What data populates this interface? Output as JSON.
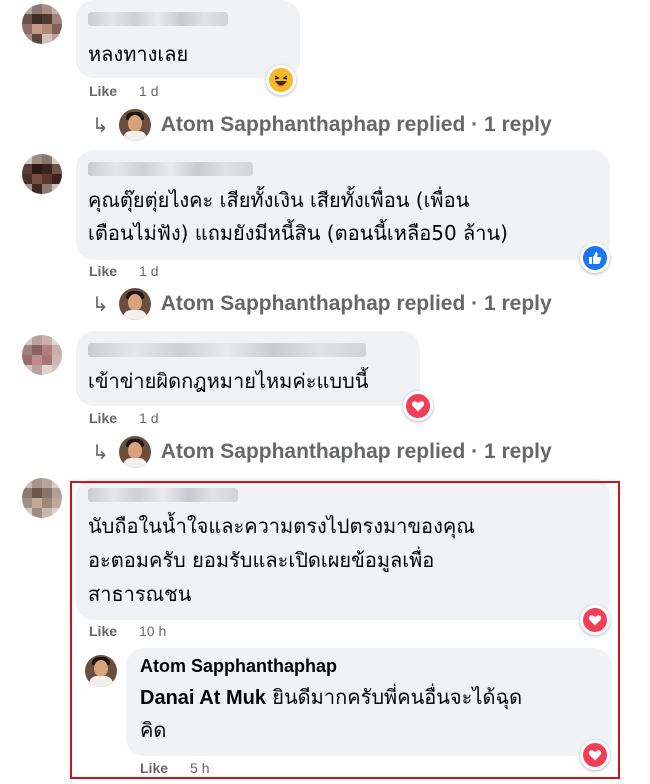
{
  "comments": [
    {
      "text_lines": [
        "หลงทางเลย"
      ],
      "like_label": "Like",
      "time": "1 d",
      "reaction_icon": "haha-icon",
      "reply_summary": "Atom Sapphanthaphap replied · 1 reply"
    },
    {
      "text_lines": [
        "คุณตุ๊ยตุ่ยไงคะ เสียทั้งเงิน เสียทั้งเพื่อน (เพื่อน",
        "เตือนไม่ฟัง) แถมยังมีหนี้สิน (ตอนนี้เหลือ50 ล้าน)"
      ],
      "like_label": "Like",
      "time": "1 d",
      "reaction_icon": "like-icon",
      "reply_summary": "Atom Sapphanthaphap replied · 1 reply"
    },
    {
      "text_lines": [
        "เข้าข่ายผิดกฎหมายไหมค่ะแบบนี้"
      ],
      "like_label": "Like",
      "time": "1 d",
      "reaction_icon": "love-icon",
      "reply_summary": "Atom Sapphanthaphap replied · 1 reply"
    },
    {
      "text_lines": [
        "นับถือในน้ำใจและความตรงไปตรงมาของคุณ",
        "อะตอมครับ ยอมรับและเปิดเผยข้อมูลเพื่อ",
        "สาธารณชน"
      ],
      "like_label": "Like",
      "time": "10 h",
      "reaction_icon": "love-icon"
    }
  ],
  "reply": {
    "author": "Atom Sapphanthaphap",
    "mention": "Danai At Muk",
    "text_line1": " ยินดีมากครับพี่คนอื่นจะได้ฉุด",
    "text_line2": "คิด",
    "like_label": "Like",
    "time": "5 h",
    "reaction_icon": "love-icon"
  },
  "colors": {
    "bubble": "#f0f2f5",
    "meta": "#65676b",
    "like_blue": "#1877f2",
    "love_red": "#f33e58",
    "highlight": "#d0121b"
  }
}
